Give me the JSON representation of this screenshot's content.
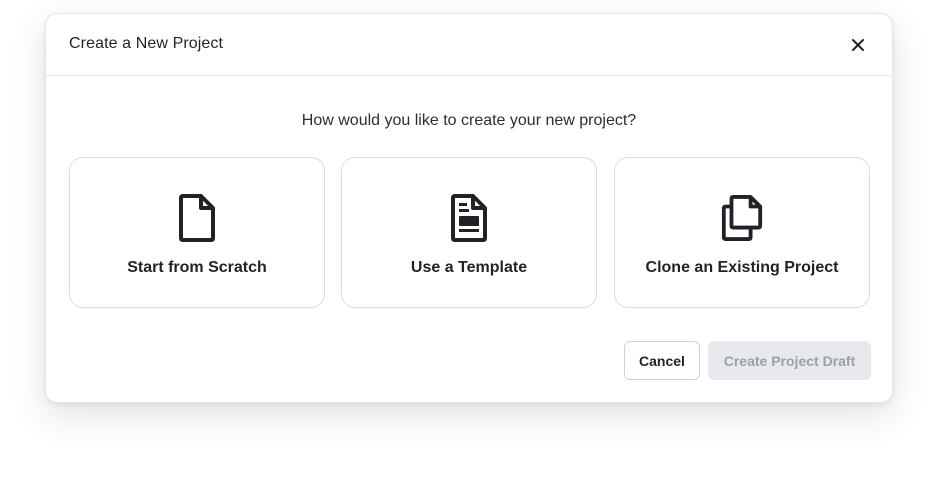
{
  "dialog": {
    "title": "Create a New Project",
    "question": "How would you like to create your new project?",
    "options": [
      {
        "label": "Start from Scratch",
        "icon": "document-icon"
      },
      {
        "label": "Use a Template",
        "icon": "template-icon"
      },
      {
        "label": "Clone an Existing Project",
        "icon": "clone-icon"
      }
    ],
    "buttons": {
      "cancel_label": "Cancel",
      "create_label": "Create Project Draft"
    }
  },
  "colors": {
    "icon": "#1f2328",
    "border": "#d9dce0",
    "disabled_bg": "#e7e9ec",
    "disabled_text": "#9ba1a8"
  }
}
